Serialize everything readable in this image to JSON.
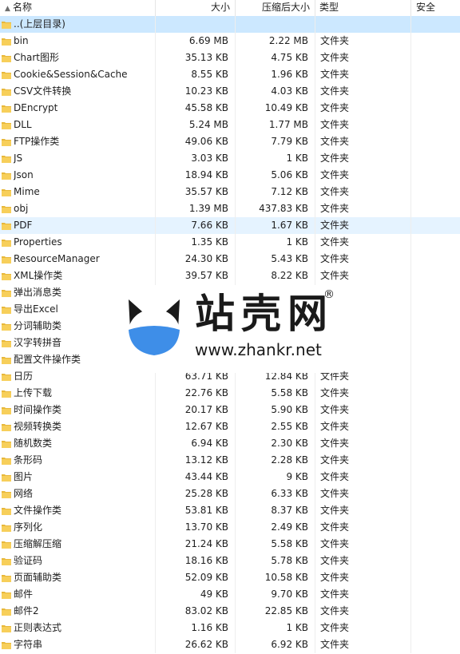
{
  "colors": {
    "selection": "#cce8ff",
    "hover": "#e5f3ff",
    "folder": "#f7cf5a",
    "watermark_blue": "#3e8ee8"
  },
  "header": {
    "name": "名称",
    "size": "大小",
    "compressed_size": "压缩后大小",
    "type": "类型",
    "security": "安全"
  },
  "parent_row": {
    "name": "..(上层目录)"
  },
  "rows": [
    {
      "name": "bin",
      "size": "6.69 MB",
      "csize": "2.22 MB",
      "type": "文件夹"
    },
    {
      "name": "Chart图形",
      "size": "35.13 KB",
      "csize": "4.75 KB",
      "type": "文件夹"
    },
    {
      "name": "Cookie&Session&Cache",
      "size": "8.55 KB",
      "csize": "1.96 KB",
      "type": "文件夹"
    },
    {
      "name": "CSV文件转换",
      "size": "10.23 KB",
      "csize": "4.03 KB",
      "type": "文件夹"
    },
    {
      "name": "DEncrypt",
      "size": "45.58 KB",
      "csize": "10.49 KB",
      "type": "文件夹"
    },
    {
      "name": "DLL",
      "size": "5.24 MB",
      "csize": "1.77 MB",
      "type": "文件夹"
    },
    {
      "name": "FTP操作类",
      "size": "49.06 KB",
      "csize": "7.79 KB",
      "type": "文件夹"
    },
    {
      "name": "JS",
      "size": "3.03 KB",
      "csize": "1 KB",
      "type": "文件夹"
    },
    {
      "name": "Json",
      "size": "18.94 KB",
      "csize": "5.06 KB",
      "type": "文件夹"
    },
    {
      "name": "Mime",
      "size": "35.57 KB",
      "csize": "7.12 KB",
      "type": "文件夹"
    },
    {
      "name": "obj",
      "size": "1.39 MB",
      "csize": "437.83 KB",
      "type": "文件夹"
    },
    {
      "name": "PDF",
      "size": "7.66 KB",
      "csize": "1.67 KB",
      "type": "文件夹"
    },
    {
      "name": "Properties",
      "size": "1.35 KB",
      "csize": "1 KB",
      "type": "文件夹"
    },
    {
      "name": "ResourceManager",
      "size": "24.30 KB",
      "csize": "5.43 KB",
      "type": "文件夹"
    },
    {
      "name": "XML操作类",
      "size": "39.57 KB",
      "csize": "8.22 KB",
      "type": "文件夹"
    },
    {
      "name": "弹出消息类",
      "size": "",
      "csize": "",
      "type": ""
    },
    {
      "name": "导出Excel",
      "size": "",
      "csize": "",
      "type": ""
    },
    {
      "name": "分词辅助类",
      "size": "",
      "csize": "",
      "type": ""
    },
    {
      "name": "汉字转拼音",
      "size": "",
      "csize": "",
      "type": ""
    },
    {
      "name": "配置文件操作类",
      "size": "",
      "csize": "",
      "type": ""
    },
    {
      "name": "日历",
      "size": "63.71 KB",
      "csize": "12.84 KB",
      "type": "文件夹"
    },
    {
      "name": "上传下载",
      "size": "22.76 KB",
      "csize": "5.58 KB",
      "type": "文件夹"
    },
    {
      "name": "时间操作类",
      "size": "20.17 KB",
      "csize": "5.90 KB",
      "type": "文件夹"
    },
    {
      "name": "视频转换类",
      "size": "12.67 KB",
      "csize": "2.55 KB",
      "type": "文件夹"
    },
    {
      "name": "随机数类",
      "size": "6.94 KB",
      "csize": "2.30 KB",
      "type": "文件夹"
    },
    {
      "name": "条形码",
      "size": "13.12 KB",
      "csize": "2.28 KB",
      "type": "文件夹"
    },
    {
      "name": "图片",
      "size": "43.44 KB",
      "csize": "9 KB",
      "type": "文件夹"
    },
    {
      "name": "网络",
      "size": "25.28 KB",
      "csize": "6.33 KB",
      "type": "文件夹"
    },
    {
      "name": "文件操作类",
      "size": "53.81 KB",
      "csize": "8.37 KB",
      "type": "文件夹"
    },
    {
      "name": "序列化",
      "size": "13.70 KB",
      "csize": "2.49 KB",
      "type": "文件夹"
    },
    {
      "name": "压缩解压缩",
      "size": "21.24 KB",
      "csize": "5.58 KB",
      "type": "文件夹"
    },
    {
      "name": "验证码",
      "size": "18.16 KB",
      "csize": "5.78 KB",
      "type": "文件夹"
    },
    {
      "name": "页面辅助类",
      "size": "52.09 KB",
      "csize": "10.58 KB",
      "type": "文件夹"
    },
    {
      "name": "邮件",
      "size": "49 KB",
      "csize": "9.70 KB",
      "type": "文件夹"
    },
    {
      "name": "邮件2",
      "size": "83.02 KB",
      "csize": "22.85 KB",
      "type": "文件夹"
    },
    {
      "name": "正则表达式",
      "size": "1.16 KB",
      "csize": "1 KB",
      "type": "文件夹"
    },
    {
      "name": "字符串",
      "size": "26.62 KB",
      "csize": "6.92 KB",
      "type": "文件夹"
    }
  ],
  "watermark": {
    "title": "站壳网",
    "reg": "®",
    "url": "www.zhankr.net"
  }
}
